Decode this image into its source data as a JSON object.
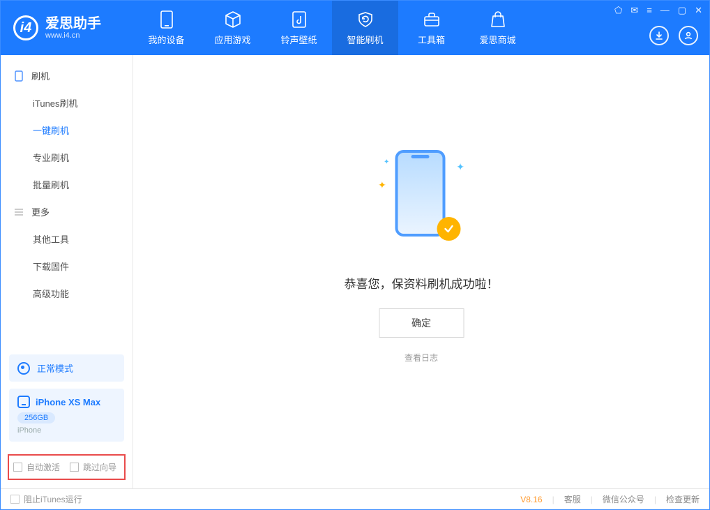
{
  "app": {
    "name_cn": "爱思助手",
    "domain": "www.i4.cn"
  },
  "nav": {
    "items": [
      {
        "label": "我的设备"
      },
      {
        "label": "应用游戏"
      },
      {
        "label": "铃声壁纸"
      },
      {
        "label": "智能刷机",
        "active": true
      },
      {
        "label": "工具箱"
      },
      {
        "label": "爱思商城"
      }
    ]
  },
  "sidebar": {
    "sections": [
      {
        "title": "刷机",
        "items": [
          {
            "label": "iTunes刷机"
          },
          {
            "label": "一键刷机",
            "active": true
          },
          {
            "label": "专业刷机"
          },
          {
            "label": "批量刷机"
          }
        ]
      },
      {
        "title": "更多",
        "items": [
          {
            "label": "其他工具"
          },
          {
            "label": "下载固件"
          },
          {
            "label": "高级功能"
          }
        ]
      }
    ],
    "mode": "正常模式",
    "device": {
      "name": "iPhone XS Max",
      "capacity": "256GB",
      "type": "iPhone"
    },
    "options": {
      "auto_activate": "自动激活",
      "skip_guide": "跳过向导"
    }
  },
  "main": {
    "success_msg": "恭喜您，保资料刷机成功啦！",
    "ok": "确定",
    "view_log": "查看日志"
  },
  "status": {
    "block_itunes": "阻止iTunes运行",
    "version": "V8.16",
    "links": {
      "cs": "客服",
      "wechat": "微信公众号",
      "update": "检查更新"
    }
  }
}
